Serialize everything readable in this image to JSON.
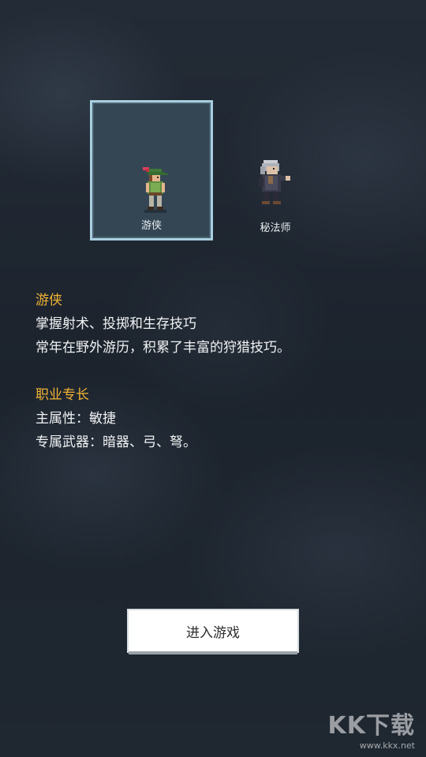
{
  "characters": [
    {
      "name": "游侠",
      "selected": true,
      "icon": "ranger-sprite"
    },
    {
      "name": "秘法师",
      "selected": false,
      "icon": "mage-sprite"
    }
  ],
  "info": {
    "class_name": "游侠",
    "description_1": "掌握射术、投掷和生存技巧",
    "description_2": "常年在野外游历，积累了丰富的狩猎技巧。",
    "specialty_heading": "职业专长",
    "main_attribute": "主属性：敏捷",
    "weapons": "专属武器：暗器、弓、弩。"
  },
  "start_button": "进入游戏",
  "watermark": {
    "logo": "KK下载",
    "url": "www.kkx.net"
  },
  "colors": {
    "highlight": "#f2b434",
    "selected_border": "#a8cfe0"
  }
}
